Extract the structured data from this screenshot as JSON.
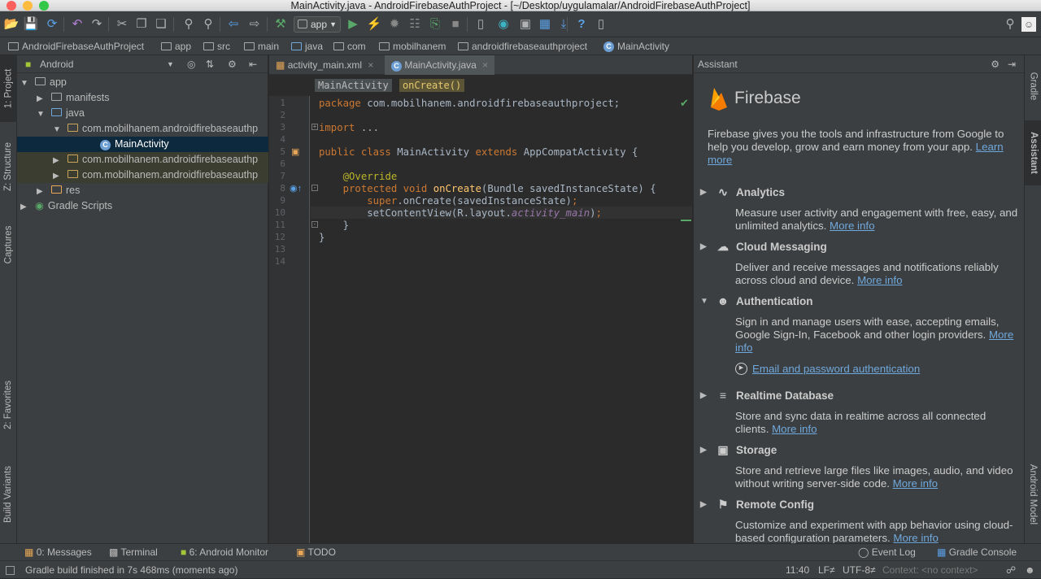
{
  "window": {
    "title": "MainActivity.java - AndroidFirebaseAuthProject - [~/Desktop/uygulamalar/AndroidFirebaseAuthProject]"
  },
  "toolbar": {
    "run_config": "app"
  },
  "breadcrumbs": [
    "AndroidFirebaseAuthProject",
    "app",
    "src",
    "main",
    "java",
    "com",
    "mobilhanem",
    "androidfirebaseauthproject",
    "MainActivity"
  ],
  "left_tabs": {
    "project": "1: Project",
    "structure": "Z: Structure",
    "captures": "Captures",
    "favorites": "2: Favorites",
    "build_variants": "Build Variants"
  },
  "right_tabs": {
    "gradle": "Gradle",
    "assistant": "Assistant",
    "android_model": "Android Model"
  },
  "project_panel": {
    "view": "Android",
    "tree": [
      {
        "label": "app",
        "level": 0,
        "expanded": true,
        "icon": "module-icon"
      },
      {
        "label": "manifests",
        "level": 1,
        "expanded": false,
        "icon": "folder-icon"
      },
      {
        "label": "java",
        "level": 1,
        "expanded": true,
        "icon": "folder-icon"
      },
      {
        "label": "com.mobilhanem.androidfirebaseauthp",
        "level": 2,
        "expanded": true,
        "icon": "package-icon"
      },
      {
        "label": "MainActivity",
        "level": 3,
        "expanded": null,
        "icon": "class-icon",
        "selected": true
      },
      {
        "label": "com.mobilhanem.androidfirebaseauthp",
        "level": 2,
        "expanded": false,
        "icon": "package-icon"
      },
      {
        "label": "com.mobilhanem.androidfirebaseauthp",
        "level": 2,
        "expanded": false,
        "icon": "package-icon"
      },
      {
        "label": "res",
        "level": 1,
        "expanded": false,
        "icon": "res-folder-icon"
      },
      {
        "label": "Gradle Scripts",
        "level": 0,
        "expanded": false,
        "icon": "gradle-icon"
      }
    ]
  },
  "editor": {
    "tabs": [
      {
        "label": "activity_main.xml",
        "active": false
      },
      {
        "label": "MainActivity.java",
        "active": true
      }
    ],
    "breadcrumb": [
      "MainActivity",
      "onCreate()"
    ],
    "line_numbers": [
      "1",
      "2",
      "3",
      "4",
      "5",
      "6",
      "7",
      "8",
      "9",
      "10",
      "11",
      "12",
      "13",
      "14"
    ],
    "lines": [
      [
        {
          "t": "package ",
          "c": "kw"
        },
        {
          "t": "com.mobilhanem.androidfirebaseauthproject;",
          "c": ""
        }
      ],
      [],
      [
        {
          "t": "import ",
          "c": "kw"
        },
        {
          "t": "...",
          "c": ""
        }
      ],
      [],
      [
        {
          "t": "public class ",
          "c": "kw"
        },
        {
          "t": "MainActivity ",
          "c": ""
        },
        {
          "t": "extends ",
          "c": "kw"
        },
        {
          "t": "AppCompatActivity {",
          "c": ""
        }
      ],
      [],
      [
        {
          "t": "    ",
          "c": ""
        },
        {
          "t": "@Override",
          "c": "an"
        }
      ],
      [
        {
          "t": "    ",
          "c": ""
        },
        {
          "t": "protected void ",
          "c": "kw"
        },
        {
          "t": "onCreate",
          "c": "fn"
        },
        {
          "t": "(Bundle savedInstanceState) {",
          "c": ""
        }
      ],
      [
        {
          "t": "        ",
          "c": ""
        },
        {
          "t": "super",
          "c": "kw"
        },
        {
          "t": ".onCreate(savedInstanceState)",
          "c": ""
        },
        {
          "t": ";",
          "c": "kw"
        }
      ],
      [
        {
          "t": "        setContentView(R.layout.",
          "c": ""
        },
        {
          "t": "activity_main",
          "c": "it"
        },
        {
          "t": ")",
          "c": ""
        },
        {
          "t": ";",
          "c": "kw"
        }
      ],
      [
        {
          "t": "    }",
          "c": ""
        }
      ],
      [
        {
          "t": "}",
          "c": ""
        }
      ],
      [],
      []
    ]
  },
  "assistant": {
    "title": "Assistant",
    "brand": "Firebase",
    "intro": "Firebase gives you the tools and infrastructure from Google to help you develop, grow and earn money from your app.",
    "learn_more": "Learn more",
    "features": [
      {
        "name": "Analytics",
        "icon": "analytics-icon",
        "desc": "Measure user activity and engagement with free, easy, and unlimited analytics.",
        "link": "More info",
        "expanded": false
      },
      {
        "name": "Cloud Messaging",
        "icon": "cloud-icon",
        "desc": "Deliver and receive messages and notifications reliably across cloud and device.",
        "link": "More info",
        "expanded": false
      },
      {
        "name": "Authentication",
        "icon": "users-icon",
        "desc": "Sign in and manage users with ease, accepting emails, Google Sign-In, Facebook and other login providers.",
        "link": "More info",
        "expanded": true,
        "sub_link": "Email and password authentication"
      },
      {
        "name": "Realtime Database",
        "icon": "database-icon",
        "desc": "Store and sync data in realtime across all connected clients.",
        "link": "More info",
        "expanded": false
      },
      {
        "name": "Storage",
        "icon": "image-icon",
        "desc": "Store and retrieve large files like images, audio, and video without writing server-side code.",
        "link": "More info",
        "expanded": false
      },
      {
        "name": "Remote Config",
        "icon": "config-icon",
        "desc": "Customize and experiment with app behavior using cloud-based configuration parameters.",
        "link": "More info",
        "expanded": false
      }
    ]
  },
  "bottom_tabs": {
    "messages": "0: Messages",
    "terminal": "Terminal",
    "monitor": "6: Android Monitor",
    "todo": "TODO",
    "event_log": "Event Log",
    "gradle_console": "Gradle Console"
  },
  "status": {
    "message": "Gradle build finished in 7s 468ms (moments ago)",
    "position": "11:40",
    "line_sep": "LF≠",
    "encoding": "UTF-8≠",
    "context": "Context: <no context>"
  },
  "colors": {
    "accent": "#4a88c7",
    "firebase_orange": "#ffa000",
    "background": "#2b2b2b",
    "panel": "#3c3f41"
  }
}
